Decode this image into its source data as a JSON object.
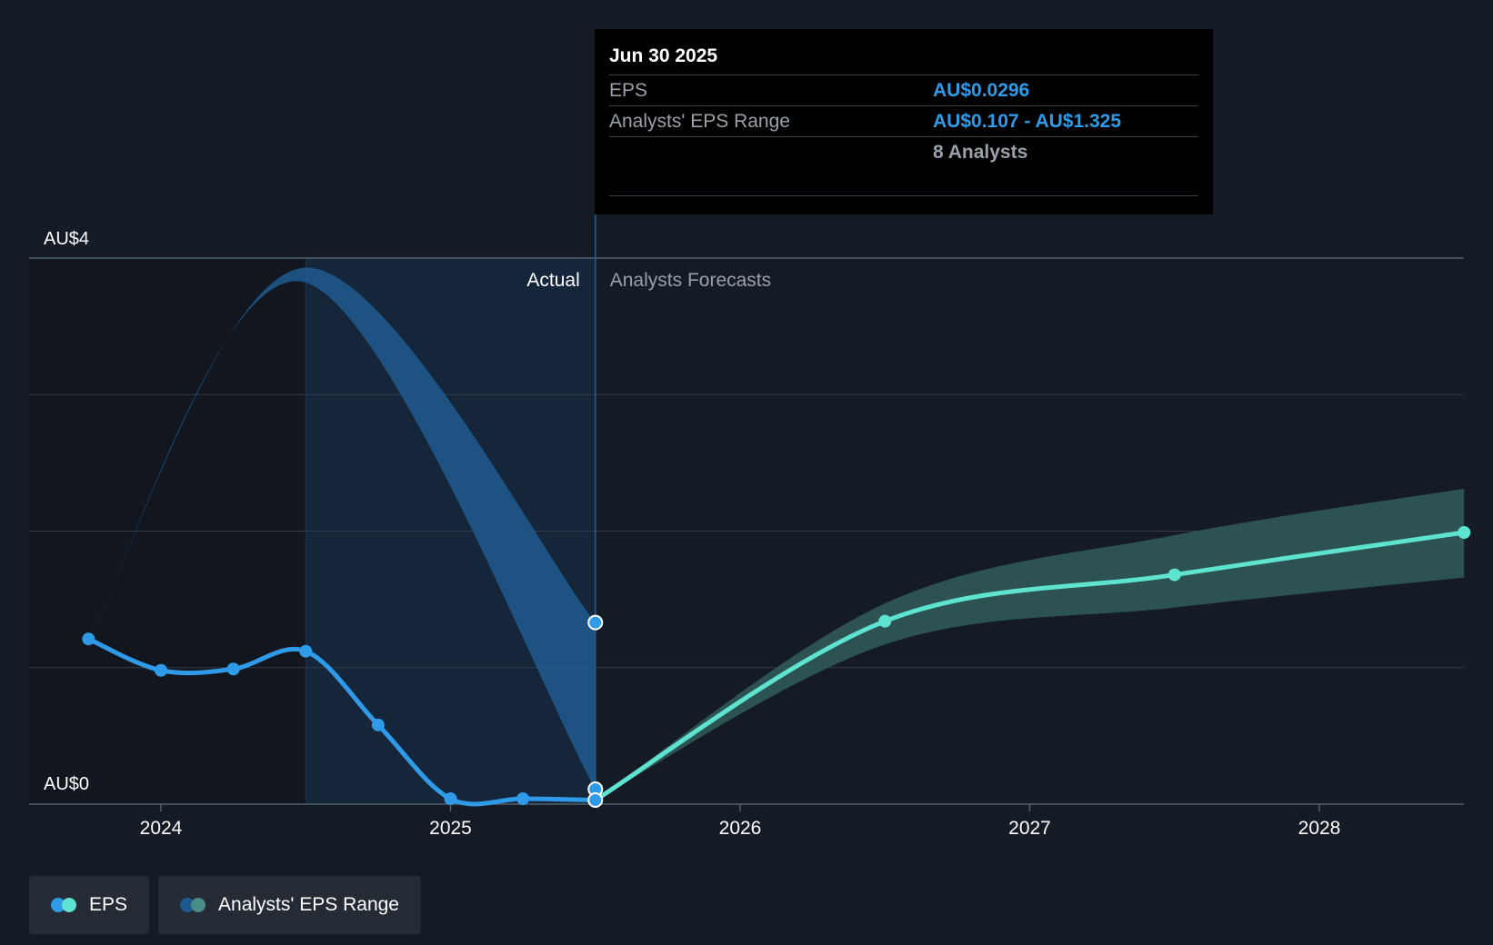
{
  "colors": {
    "background": "#151b24",
    "eps_actual": "#2f9be8",
    "eps_forecast": "#5de3cf",
    "range_actual": "#1f5a8f",
    "range_forecast": "#2f5a58",
    "gridline": "#343b46"
  },
  "tooltip": {
    "date": "Jun 30 2025",
    "eps_label": "EPS",
    "eps_value": "AU$0.0296",
    "range_label": "Analysts' EPS Range",
    "range_value": "AU$0.107 - AU$1.325",
    "analysts": "8 Analysts"
  },
  "regions": {
    "actual_label": "Actual",
    "forecast_label": "Analysts Forecasts"
  },
  "legend": {
    "eps_label": "EPS",
    "range_label": "Analysts' EPS Range"
  },
  "chart_data": {
    "type": "line",
    "y_axis_labels": [
      "AU$4",
      "AU$0"
    ],
    "x_tick_labels": [
      "2024",
      "2025",
      "2026",
      "2027",
      "2028"
    ],
    "ylim": [
      0,
      4
    ],
    "xlim": [
      2023.6,
      2028.5
    ],
    "grid": true,
    "legend_position": "bottom-left",
    "series": [
      {
        "name": "EPS",
        "segment": "actual",
        "x": [
          2023.75,
          2024.0,
          2024.25,
          2024.5,
          2024.75,
          2025.0,
          2025.25,
          2025.5
        ],
        "y": [
          1.21,
          0.98,
          0.99,
          1.12,
          0.58,
          0.04,
          0.04,
          0.03
        ]
      },
      {
        "name": "EPS",
        "segment": "forecast",
        "x": [
          2025.5,
          2026.5,
          2027.5,
          2028.5
        ],
        "y": [
          0.03,
          1.34,
          1.68,
          1.99
        ]
      },
      {
        "name": "Analysts' EPS Range",
        "segment": "actual",
        "x": [
          2023.75,
          2024.5,
          2025.5
        ],
        "high": [
          1.21,
          3.93,
          1.33
        ],
        "low": [
          1.21,
          3.82,
          0.11
        ]
      },
      {
        "name": "Analysts' EPS Range",
        "segment": "forecast",
        "x": [
          2025.5,
          2026.5,
          2027.5,
          2028.5
        ],
        "high": [
          0.03,
          1.47,
          1.97,
          2.31
        ],
        "low": [
          0.03,
          1.17,
          1.44,
          1.66
        ]
      }
    ]
  }
}
